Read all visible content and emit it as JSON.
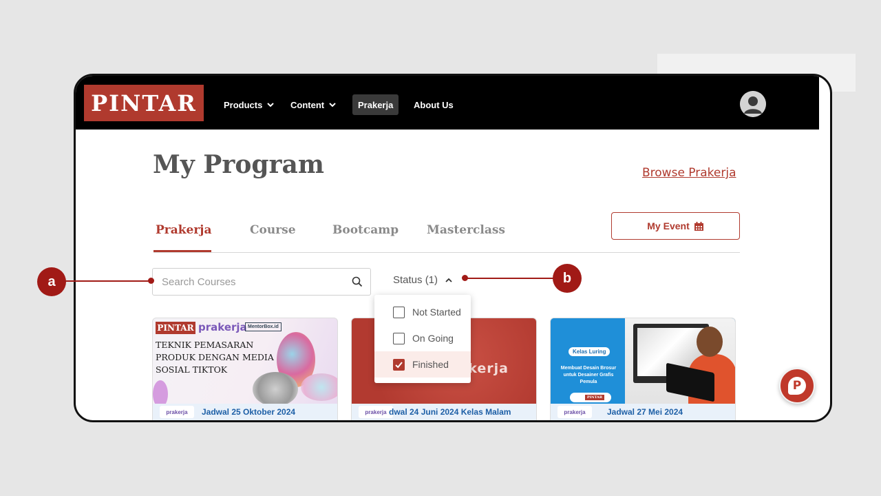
{
  "navbar": {
    "logo_text": "PINTAR",
    "items": [
      {
        "label": "Products",
        "has_dropdown": true
      },
      {
        "label": "Content",
        "has_dropdown": true
      },
      {
        "label": "Prakerja",
        "active": true
      },
      {
        "label": "About Us"
      }
    ],
    "avatar_icon": "user-avatar-icon"
  },
  "main": {
    "title": "My Program",
    "browse_link": "Browse Prakerja",
    "tabs": [
      {
        "label": "Prakerja",
        "active": true
      },
      {
        "label": "Course"
      },
      {
        "label": "Bootcamp"
      },
      {
        "label": "Masterclass"
      }
    ],
    "event_button": "My Event",
    "event_icon": "calendar-icon"
  },
  "search": {
    "placeholder": "Search Courses",
    "value": "",
    "icon": "search-icon"
  },
  "status_filter": {
    "label": "Status (1)",
    "expanded": true,
    "options": [
      {
        "label": "Not Started",
        "checked": false
      },
      {
        "label": "On Going",
        "checked": false
      },
      {
        "label": "Finished",
        "checked": true
      }
    ]
  },
  "cards": [
    {
      "logo": "PINTAR",
      "partner_logo": "prakerja",
      "partner2": "MentorBox.id",
      "title": "TEKNIK PEMASARAN PRODUK DENGAN MEDIA SOSIAL TIKTOK",
      "schedule": "Jadwal 25 Oktober 2024",
      "footer_logo": "prakerja"
    },
    {
      "brand_text": "rakerja",
      "schedule": "dwal 24 Juni 2024 Kelas Malam",
      "footer_logo": "prakerja"
    },
    {
      "badge": "Kelas Luring",
      "title": "Membuat Desain Brosur untuk Desainer Grafis Pemula",
      "pill_logo": "PINTAR",
      "schedule": "Jadwal 27 Mei 2024",
      "footer_logo": "prakerja"
    }
  ],
  "chat_fab": {
    "icon": "chat-p-icon",
    "glyph": "P"
  },
  "annotations": {
    "a": "a",
    "b": "b"
  },
  "colors": {
    "brand": "#b03a2e",
    "navbar": "#000000",
    "annotation": "#a11a16",
    "link": "#1d5fa6"
  }
}
